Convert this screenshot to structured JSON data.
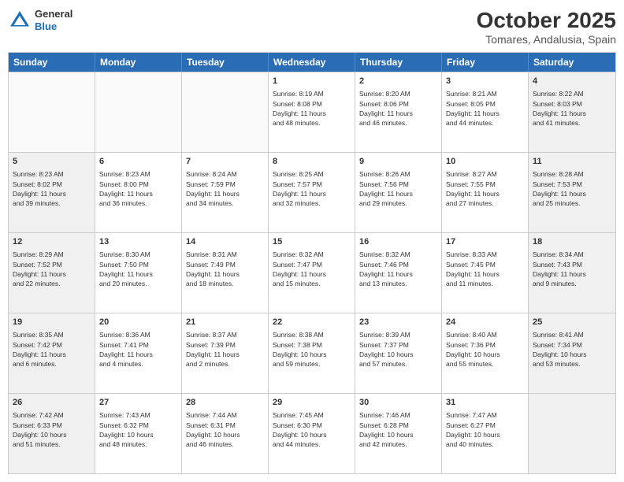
{
  "header": {
    "logo": {
      "general": "General",
      "blue": "Blue"
    },
    "title": "October 2025",
    "location": "Tomares, Andalusia, Spain"
  },
  "days": [
    "Sunday",
    "Monday",
    "Tuesday",
    "Wednesday",
    "Thursday",
    "Friday",
    "Saturday"
  ],
  "rows": [
    [
      {
        "num": "",
        "text": "",
        "empty": true
      },
      {
        "num": "",
        "text": "",
        "empty": true
      },
      {
        "num": "",
        "text": "",
        "empty": true
      },
      {
        "num": "1",
        "text": "Sunrise: 8:19 AM\nSunset: 8:08 PM\nDaylight: 11 hours\nand 48 minutes.",
        "empty": false
      },
      {
        "num": "2",
        "text": "Sunrise: 8:20 AM\nSunset: 8:06 PM\nDaylight: 11 hours\nand 46 minutes.",
        "empty": false
      },
      {
        "num": "3",
        "text": "Sunrise: 8:21 AM\nSunset: 8:05 PM\nDaylight: 11 hours\nand 44 minutes.",
        "empty": false
      },
      {
        "num": "4",
        "text": "Sunrise: 8:22 AM\nSunset: 8:03 PM\nDaylight: 11 hours\nand 41 minutes.",
        "empty": false,
        "shaded": true
      }
    ],
    [
      {
        "num": "5",
        "text": "Sunrise: 8:23 AM\nSunset: 8:02 PM\nDaylight: 11 hours\nand 39 minutes.",
        "empty": false,
        "shaded": true
      },
      {
        "num": "6",
        "text": "Sunrise: 8:23 AM\nSunset: 8:00 PM\nDaylight: 11 hours\nand 36 minutes.",
        "empty": false
      },
      {
        "num": "7",
        "text": "Sunrise: 8:24 AM\nSunset: 7:59 PM\nDaylight: 11 hours\nand 34 minutes.",
        "empty": false
      },
      {
        "num": "8",
        "text": "Sunrise: 8:25 AM\nSunset: 7:57 PM\nDaylight: 11 hours\nand 32 minutes.",
        "empty": false
      },
      {
        "num": "9",
        "text": "Sunrise: 8:26 AM\nSunset: 7:56 PM\nDaylight: 11 hours\nand 29 minutes.",
        "empty": false
      },
      {
        "num": "10",
        "text": "Sunrise: 8:27 AM\nSunset: 7:55 PM\nDaylight: 11 hours\nand 27 minutes.",
        "empty": false
      },
      {
        "num": "11",
        "text": "Sunrise: 8:28 AM\nSunset: 7:53 PM\nDaylight: 11 hours\nand 25 minutes.",
        "empty": false,
        "shaded": true
      }
    ],
    [
      {
        "num": "12",
        "text": "Sunrise: 8:29 AM\nSunset: 7:52 PM\nDaylight: 11 hours\nand 22 minutes.",
        "empty": false,
        "shaded": true
      },
      {
        "num": "13",
        "text": "Sunrise: 8:30 AM\nSunset: 7:50 PM\nDaylight: 11 hours\nand 20 minutes.",
        "empty": false
      },
      {
        "num": "14",
        "text": "Sunrise: 8:31 AM\nSunset: 7:49 PM\nDaylight: 11 hours\nand 18 minutes.",
        "empty": false
      },
      {
        "num": "15",
        "text": "Sunrise: 8:32 AM\nSunset: 7:47 PM\nDaylight: 11 hours\nand 15 minutes.",
        "empty": false
      },
      {
        "num": "16",
        "text": "Sunrise: 8:32 AM\nSunset: 7:46 PM\nDaylight: 11 hours\nand 13 minutes.",
        "empty": false
      },
      {
        "num": "17",
        "text": "Sunrise: 8:33 AM\nSunset: 7:45 PM\nDaylight: 11 hours\nand 11 minutes.",
        "empty": false
      },
      {
        "num": "18",
        "text": "Sunrise: 8:34 AM\nSunset: 7:43 PM\nDaylight: 11 hours\nand 9 minutes.",
        "empty": false,
        "shaded": true
      }
    ],
    [
      {
        "num": "19",
        "text": "Sunrise: 8:35 AM\nSunset: 7:42 PM\nDaylight: 11 hours\nand 6 minutes.",
        "empty": false,
        "shaded": true
      },
      {
        "num": "20",
        "text": "Sunrise: 8:36 AM\nSunset: 7:41 PM\nDaylight: 11 hours\nand 4 minutes.",
        "empty": false
      },
      {
        "num": "21",
        "text": "Sunrise: 8:37 AM\nSunset: 7:39 PM\nDaylight: 11 hours\nand 2 minutes.",
        "empty": false
      },
      {
        "num": "22",
        "text": "Sunrise: 8:38 AM\nSunset: 7:38 PM\nDaylight: 10 hours\nand 59 minutes.",
        "empty": false
      },
      {
        "num": "23",
        "text": "Sunrise: 8:39 AM\nSunset: 7:37 PM\nDaylight: 10 hours\nand 57 minutes.",
        "empty": false
      },
      {
        "num": "24",
        "text": "Sunrise: 8:40 AM\nSunset: 7:36 PM\nDaylight: 10 hours\nand 55 minutes.",
        "empty": false
      },
      {
        "num": "25",
        "text": "Sunrise: 8:41 AM\nSunset: 7:34 PM\nDaylight: 10 hours\nand 53 minutes.",
        "empty": false,
        "shaded": true
      }
    ],
    [
      {
        "num": "26",
        "text": "Sunrise: 7:42 AM\nSunset: 6:33 PM\nDaylight: 10 hours\nand 51 minutes.",
        "empty": false,
        "shaded": true
      },
      {
        "num": "27",
        "text": "Sunrise: 7:43 AM\nSunset: 6:32 PM\nDaylight: 10 hours\nand 48 minutes.",
        "empty": false
      },
      {
        "num": "28",
        "text": "Sunrise: 7:44 AM\nSunset: 6:31 PM\nDaylight: 10 hours\nand 46 minutes.",
        "empty": false
      },
      {
        "num": "29",
        "text": "Sunrise: 7:45 AM\nSunset: 6:30 PM\nDaylight: 10 hours\nand 44 minutes.",
        "empty": false
      },
      {
        "num": "30",
        "text": "Sunrise: 7:46 AM\nSunset: 6:28 PM\nDaylight: 10 hours\nand 42 minutes.",
        "empty": false
      },
      {
        "num": "31",
        "text": "Sunrise: 7:47 AM\nSunset: 6:27 PM\nDaylight: 10 hours\nand 40 minutes.",
        "empty": false
      },
      {
        "num": "",
        "text": "",
        "empty": true,
        "shaded": true
      }
    ]
  ]
}
